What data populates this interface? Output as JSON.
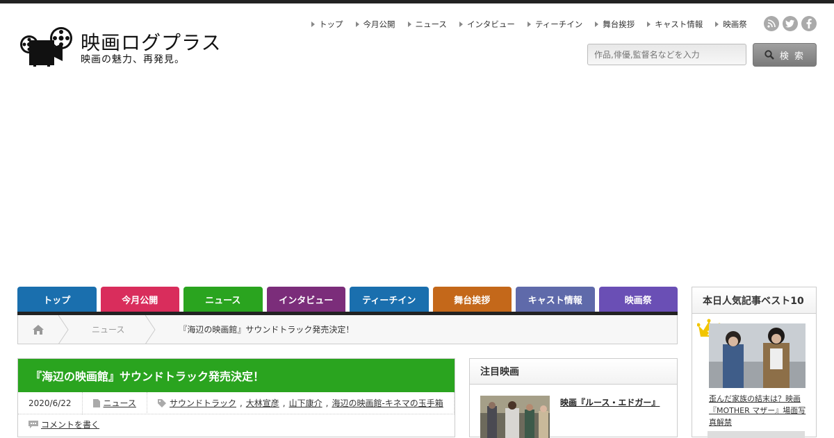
{
  "site": {
    "title": "映画ログプラス",
    "tagline": "映画の魅力、再発見。"
  },
  "topnav": {
    "items": [
      "トップ",
      "今月公開",
      "ニュース",
      "インタビュー",
      "ティーチイン",
      "舞台挨拶",
      "キャスト情報",
      "映画祭"
    ]
  },
  "social": {
    "icons": [
      "rss-icon",
      "twitter-icon",
      "facebook-icon"
    ]
  },
  "search": {
    "placeholder": "作品,俳優,監督名などを入力",
    "button_label": "検 索"
  },
  "catnav": {
    "tabs": [
      {
        "label": "トップ",
        "color": "#1a6fae"
      },
      {
        "label": "今月公開",
        "color": "#d92d5c"
      },
      {
        "label": "ニュース",
        "color": "#2aa41f"
      },
      {
        "label": "インタビュー",
        "color": "#7b2d7a"
      },
      {
        "label": "ティーチイン",
        "color": "#1a6fae"
      },
      {
        "label": "舞台挨拶",
        "color": "#c4681a"
      },
      {
        "label": "キャスト情報",
        "color": "#5f6aaa"
      },
      {
        "label": "映画祭",
        "color": "#6a4fb5"
      }
    ]
  },
  "breadcrumb": {
    "category": "ニュース",
    "current": "『海辺の映画館』サウンドトラック発売決定！"
  },
  "article": {
    "title": "『海辺の映画館』サウンドトラック発売決定！",
    "date": "2020/6/22",
    "category": "ニュース",
    "tags": [
      "サウンドトラック",
      "大林宣彦",
      "山下康介",
      "海辺の映画館-キネマの玉手箱"
    ],
    "comment_link": "コメントを書く"
  },
  "featured": {
    "heading": "注目映画",
    "title": "映画『ルース・エドガー』"
  },
  "popular": {
    "heading": "本日人気記事ベスト10",
    "rank1_title": "歪んだ家族の結末は？映画『MOTHER マザー』場面写真解禁"
  },
  "colors": {
    "accent_green": "#2aa41f",
    "topbar": "#222222"
  }
}
